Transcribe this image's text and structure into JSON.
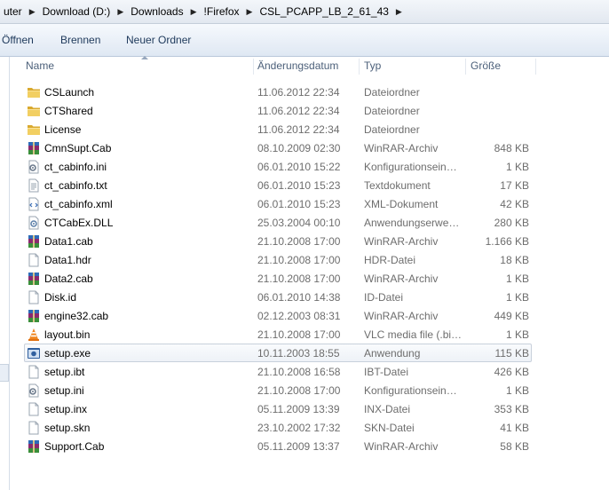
{
  "address": {
    "crumbs": [
      "uter",
      "Download (D:)",
      "Downloads",
      "!Firefox",
      "CSL_PCAPP_LB_2_61_43"
    ]
  },
  "toolbar": {
    "open_label": "Öffnen",
    "burn_label": "Brennen",
    "new_folder_label": "Neuer Ordner"
  },
  "columns": {
    "name": "Name",
    "date": "Änderungsdatum",
    "type": "Typ",
    "size": "Größe"
  },
  "files": [
    {
      "name": "CSLaunch",
      "date": "11.06.2012 22:34",
      "type": "Dateiordner",
      "size": "",
      "icon": "folder-icon"
    },
    {
      "name": "CTShared",
      "date": "11.06.2012 22:34",
      "type": "Dateiordner",
      "size": "",
      "icon": "folder-icon"
    },
    {
      "name": "License",
      "date": "11.06.2012 22:34",
      "type": "Dateiordner",
      "size": "",
      "icon": "folder-icon"
    },
    {
      "name": "CmnSupt.Cab",
      "date": "08.10.2009 02:30",
      "type": "WinRAR-Archiv",
      "size": "848 KB",
      "icon": "winrar-archive-icon"
    },
    {
      "name": "ct_cabinfo.ini",
      "date": "06.01.2010 15:22",
      "type": "Konfigurationsein…",
      "size": "1 KB",
      "icon": "settings-file-icon"
    },
    {
      "name": "ct_cabinfo.txt",
      "date": "06.01.2010 15:23",
      "type": "Textdokument",
      "size": "17 KB",
      "icon": "text-file-icon"
    },
    {
      "name": "ct_cabinfo.xml",
      "date": "06.01.2010 15:23",
      "type": "XML-Dokument",
      "size": "42 KB",
      "icon": "xml-file-icon"
    },
    {
      "name": "CTCabEx.DLL",
      "date": "25.03.2004 00:10",
      "type": "Anwendungserwe…",
      "size": "280 KB",
      "icon": "dll-file-icon"
    },
    {
      "name": "Data1.cab",
      "date": "21.10.2008 17:00",
      "type": "WinRAR-Archiv",
      "size": "1.166 KB",
      "icon": "winrar-archive-icon"
    },
    {
      "name": "Data1.hdr",
      "date": "21.10.2008 17:00",
      "type": "HDR-Datei",
      "size": "18 KB",
      "icon": "blank-file-icon"
    },
    {
      "name": "Data2.cab",
      "date": "21.10.2008 17:00",
      "type": "WinRAR-Archiv",
      "size": "1 KB",
      "icon": "winrar-archive-icon"
    },
    {
      "name": "Disk.id",
      "date": "06.01.2010 14:38",
      "type": "ID-Datei",
      "size": "1 KB",
      "icon": "blank-file-icon"
    },
    {
      "name": "engine32.cab",
      "date": "02.12.2003 08:31",
      "type": "WinRAR-Archiv",
      "size": "449 KB",
      "icon": "winrar-archive-icon"
    },
    {
      "name": "layout.bin",
      "date": "21.10.2008 17:00",
      "type": "VLC media file (.bi…",
      "size": "1 KB",
      "icon": "vlc-cone-icon"
    },
    {
      "name": "setup.exe",
      "date": "10.11.2003 18:55",
      "type": "Anwendung",
      "size": "115 KB",
      "icon": "setup-exe-icon"
    },
    {
      "name": "setup.ibt",
      "date": "21.10.2008 16:58",
      "type": "IBT-Datei",
      "size": "426 KB",
      "icon": "blank-file-icon"
    },
    {
      "name": "setup.ini",
      "date": "21.10.2008 17:00",
      "type": "Konfigurationsein…",
      "size": "1 KB",
      "icon": "settings-file-icon"
    },
    {
      "name": "setup.inx",
      "date": "05.11.2009 13:39",
      "type": "INX-Datei",
      "size": "353 KB",
      "icon": "blank-file-icon"
    },
    {
      "name": "setup.skn",
      "date": "23.10.2002 17:32",
      "type": "SKN-Datei",
      "size": "41 KB",
      "icon": "blank-file-icon"
    },
    {
      "name": "Support.Cab",
      "date": "05.11.2009 13:37",
      "type": "WinRAR-Archiv",
      "size": "58 KB",
      "icon": "winrar-archive-icon"
    }
  ],
  "hovered_file": "setup.exe",
  "colors": {
    "folder": "#e8c04a",
    "winrar": "#8a2a6e",
    "vlc": "#f0851e",
    "hover_border": "#c8d0db"
  }
}
